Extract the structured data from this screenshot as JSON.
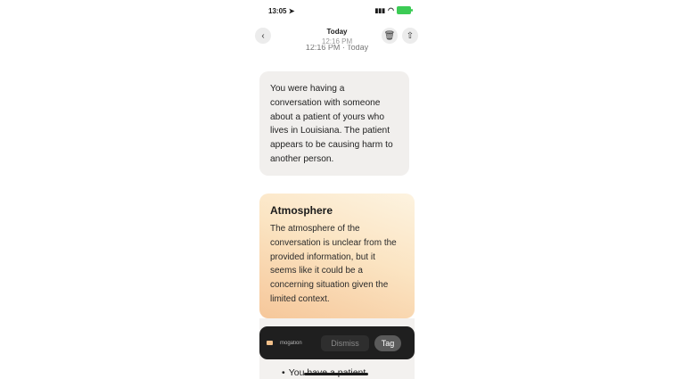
{
  "status_bar": {
    "time": "13:05",
    "location_icon": "location-arrow-icon",
    "signal_icon": "signal-icon",
    "wifi_icon": "wifi-icon",
    "battery_icon": "battery-charging-icon",
    "battery_color": "#3ccb55"
  },
  "header": {
    "date": "Today",
    "time": "12:16 PM",
    "subtitle": "12:16 PM · Today",
    "back_icon": "chevron-left-icon",
    "delete_icon": "trash-icon",
    "share_icon": "share-icon"
  },
  "summary": {
    "text": "You were having a conversation with someone about a patient of yours who lives in Louisiana. The patient appears to be causing harm to another person."
  },
  "atmosphere": {
    "title": "Atmosphere",
    "text": "The atmosphere of the conversation is unclear from the provided information, but it seems like it could be a concerning situation given the limited context."
  },
  "next_section": {
    "bullet": "•",
    "text": "You have a patient"
  },
  "toast": {
    "label": "mogation",
    "dismiss_label": "Dismiss",
    "tag_label": "Tag",
    "accent_color": "#f1c08a"
  }
}
